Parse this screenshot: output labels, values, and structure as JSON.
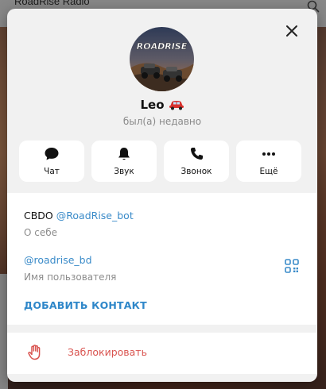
{
  "background": {
    "app_title": "RoadRise Radio",
    "search_icon": "search-icon"
  },
  "profile": {
    "avatar_icon": "roadrise-avatar",
    "avatar_logo_text": "ROADRISE",
    "name": "Leo",
    "name_badge_icon": "red-car-icon",
    "status": "был(а) недавно"
  },
  "actions": [
    {
      "label": "Чат",
      "icon": "chat-icon"
    },
    {
      "label": "Звук",
      "icon": "bell-icon"
    },
    {
      "label": "Звонок",
      "icon": "phone-icon"
    },
    {
      "label": "Ещё",
      "icon": "more-icon"
    }
  ],
  "info": {
    "bio_prefix": "CBDO",
    "bio_link": "@RoadRise_bot",
    "bio_caption": "О себе",
    "username": "@roadrise_bd",
    "username_caption": "Имя пользователя",
    "qr_icon": "qr-code-icon",
    "add_contact": "ДОБАВИТЬ КОНТАКТ"
  },
  "block": {
    "label": "Заблокировать",
    "icon": "hand-stop-icon"
  },
  "colors": {
    "accent": "#3a8bc9",
    "danger": "#d9534f",
    "modal_bg": "#f1f1f1",
    "card_bg": "#ffffff",
    "muted_text": "#8d8d8d"
  }
}
